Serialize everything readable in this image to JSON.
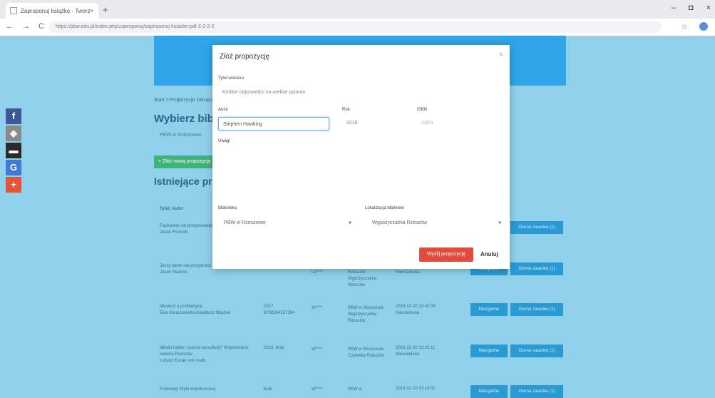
{
  "browser": {
    "tab_title": "Zaproponuj książkę - Tworzę",
    "tab_close": "×",
    "new_tab": "+",
    "url": "https://pbw.edu.pl/index.php/zaproponuj/zaproponuj-ksiazke-pdf-2-2-2-2",
    "back": "←",
    "forward": "→",
    "reload": "C",
    "star": "☆",
    "win_min": "–",
    "win_max": "◘",
    "win_close": "×"
  },
  "share": [
    "f",
    "◈",
    "▬",
    "G",
    "+"
  ],
  "page": {
    "breadcrumb": "Start  >  Propozycje zakupu",
    "heading": "Wybierz bibliotekę",
    "library_chip": "PBW w Rzeszowie",
    "add_button": "+ Złóż nową propozycję",
    "existing_heading": "Istniejące propozycje",
    "table_header": "Tytuł, Autor",
    "rows": [
      {
        "title": "Fachowiec od przeprowadzki",
        "author": "Jacek Fromnik",
        "year": "",
        "user": "",
        "lib": "",
        "date": "",
        "btn2": "Ocena zasadna (1)"
      },
      {
        "title": "Jaszy latem nie przyjdziesz",
        "author": "Jacek Havkins",
        "year": "",
        "user": "Le****",
        "lib": "Rzeszów Wypożyczalnia Rzeszów",
        "date": "Nieoceniona",
        "btn1": "Niezgodne",
        "btn2": "Ocena zasadna (1)"
      },
      {
        "title": "Młodość a profilaktyka",
        "author": "Ewa Karaszewska Arkadiusz Majcher",
        "year": "2017",
        "isbn": "9788364157384",
        "user": "W****",
        "lib": "PBW w Rzeszowie Wypożyczalnia Rzeszów",
        "date": "2016-12-20 12:40:05 Nieoceniona",
        "btn1": "Niezgodne",
        "btn2": "Ocena zasadna (1)"
      },
      {
        "title": "Młodzi ludzie: szansa na kulturę? Wspólnota w świecie Rzeszów",
        "author": "Łukasz Kozak red. nauk.",
        "year": "2016, brak",
        "user": "W****",
        "lib": "PBW w Rzeszowie Czytelnia Rzeszów",
        "date": "2016-12-20 13:23:11 Nieoceniona",
        "btn1": "Niezgodne",
        "btn2": "Ocena zasadna (1)"
      },
      {
        "title": "Podstawy fizyki współczesnej",
        "author": "",
        "year": "brak",
        "user": "W****",
        "lib": "PBW w",
        "date": "2016-12-20 13:14:51",
        "btn1": "Niezgodne",
        "btn2": "Ocena zasadna (1)"
      }
    ]
  },
  "modal": {
    "title": "Złóż propozycję",
    "close": "×",
    "title_label": "Tytuł wniosku",
    "title_value": "Krótkie odpowiedzi na wielkie pytania",
    "author_label": "Autor",
    "author_value": "Stephen Hawking",
    "year_label": "Rok",
    "year_value": "2016",
    "isbn_label": "ISBN",
    "isbn_value": "ISBN",
    "notes_label": "Uwagi",
    "library_label": "Biblioteka",
    "library_value": "PBW w Rzeszowie",
    "location_label": "Lokalizacja biblioteki",
    "location_value": "Wypożyczalnia Rzeszów",
    "send_button": "Wyślij propozycję",
    "cancel_button": "Anuluj"
  }
}
